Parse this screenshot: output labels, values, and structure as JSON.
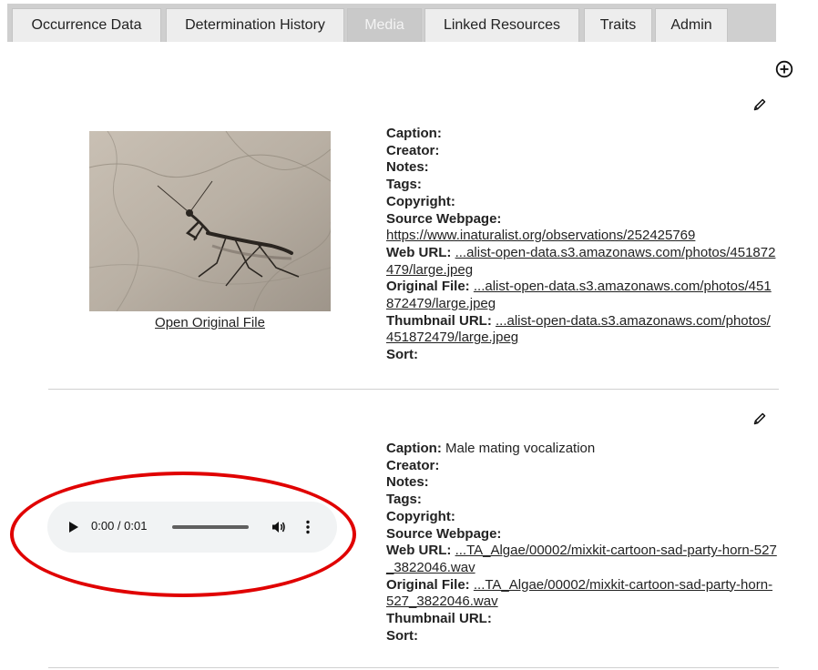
{
  "tabs": [
    {
      "label": "Occurrence Data",
      "active": false
    },
    {
      "label": "Determination History",
      "active": false
    },
    {
      "label": "Media",
      "active": true
    },
    {
      "label": "Linked Resources",
      "active": false
    },
    {
      "label": "Traits",
      "active": false
    },
    {
      "label": "Admin",
      "active": false
    }
  ],
  "icons": {
    "add": "plus-circle-icon",
    "edit": "pencil-icon"
  },
  "highlight_color": "#e00000",
  "media": [
    {
      "type": "image",
      "open_original_label": "Open Original File",
      "fields": {
        "caption_label": "Caption:",
        "caption_value": "",
        "creator_label": "Creator:",
        "notes_label": "Notes:",
        "tags_label": "Tags:",
        "copyright_label": "Copyright:",
        "source_label": "Source Webpage:",
        "source_value": "https://www.inaturalist.org/observations/252425769",
        "web_url_label": "Web URL:",
        "web_url_value": "...alist-open-data.s3.amazonaws.com/photos/451872479/large.jpeg",
        "original_label": "Original File:",
        "original_value": "...alist-open-data.s3.amazonaws.com/photos/451872479/large.jpeg",
        "thumb_label": "Thumbnail URL:",
        "thumb_value": "...alist-open-data.s3.amazonaws.com/photos/451872479/large.jpeg",
        "sort_label": "Sort:"
      }
    },
    {
      "type": "audio",
      "player": {
        "time": "0:00 / 0:01",
        "progress": 0
      },
      "fields": {
        "caption_label": "Caption:",
        "caption_value": "Male mating vocalization",
        "creator_label": "Creator:",
        "notes_label": "Notes:",
        "tags_label": "Tags:",
        "copyright_label": "Copyright:",
        "source_label": "Source Webpage:",
        "web_url_label": "Web URL:",
        "web_url_value": "...TA_Algae/00002/mixkit-cartoon-sad-party-horn-527_3822046.wav",
        "original_label": "Original File:",
        "original_value": "...TA_Algae/00002/mixkit-cartoon-sad-party-horn-527_3822046.wav",
        "thumb_label": "Thumbnail URL:",
        "sort_label": "Sort:"
      }
    }
  ]
}
